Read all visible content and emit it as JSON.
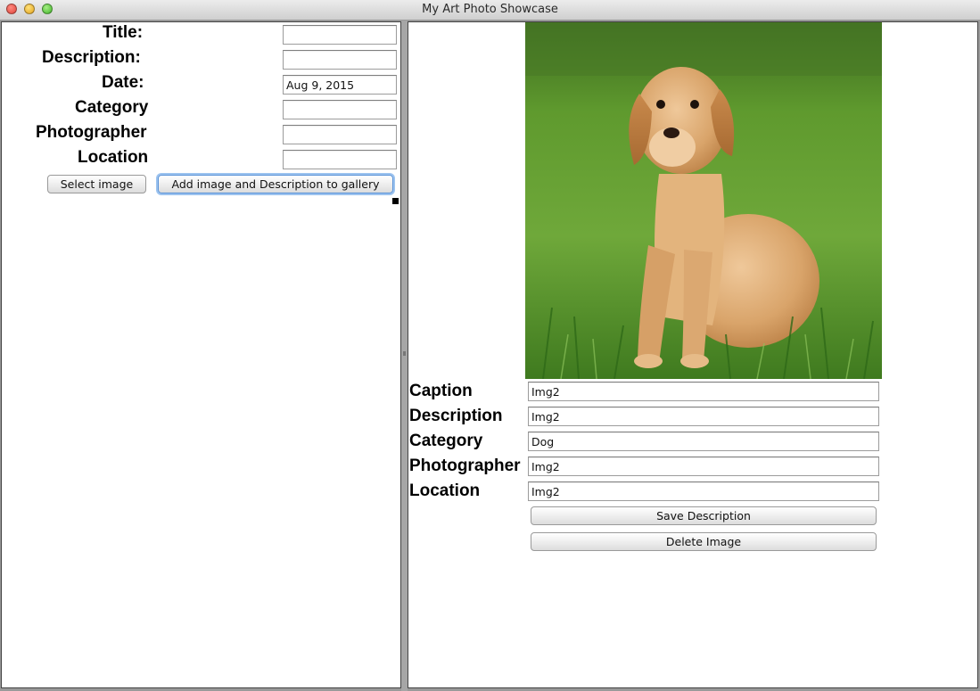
{
  "window": {
    "title": "My Art Photo Showcase"
  },
  "form": {
    "title_label": "Title:",
    "title_value": "",
    "description_label": "Description:",
    "description_value": "",
    "date_label": "Date:",
    "date_value": "Aug 9, 2015",
    "category_label": "Category",
    "category_value": "",
    "photographer_label": "Photographer",
    "photographer_value": "",
    "location_label": "Location",
    "location_value": "",
    "select_image_button": "Select image",
    "add_button": "Add image and Description to gallery"
  },
  "detail": {
    "image": {
      "subject": "golden retriever puppy sitting in grass"
    },
    "caption_label": "Caption",
    "caption_value": "Img2",
    "description_label": "Description",
    "description_value": "Img2",
    "category_label": "Category",
    "category_value": "Dog",
    "photographer_label": "Photographer",
    "photographer_value": "Img2",
    "location_label": "Location",
    "location_value": "Img2",
    "save_button": "Save Description",
    "delete_button": "Delete Image"
  }
}
